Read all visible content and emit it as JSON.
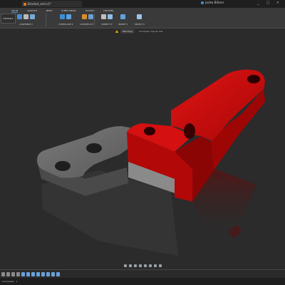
{
  "window": {
    "doc_title": "Bracket_end v1*",
    "user_label": "joshw Bittner",
    "controls": "_ □ ×",
    "home_icon": "home-icon"
  },
  "ribbon": {
    "workspace": "DESIGN ▾",
    "tabs": [
      "SOLID",
      "SURFACE",
      "MESH",
      "SHEET METAL",
      "PLASTIC",
      "UTILITIES"
    ],
    "groups": [
      "ASSEMBLE ▾",
      "CONFIGURE ▾",
      "CONSTRUCT ▾",
      "INSPECT ▾",
      "INSERT ▾",
      "SELECT ▾"
    ]
  },
  "warning": {
    "tag": "Warnings",
    "message": "Computer may be lost"
  },
  "timeline": {
    "play_icon": "play-icon"
  },
  "status": {
    "text": "Comments",
    "count": "1"
  },
  "colors": {
    "part_red": "#c40a0a",
    "part_gray": "#6a6a6a",
    "viewport_bg": "#2b2b2b",
    "accent": "#3e8ed0"
  }
}
